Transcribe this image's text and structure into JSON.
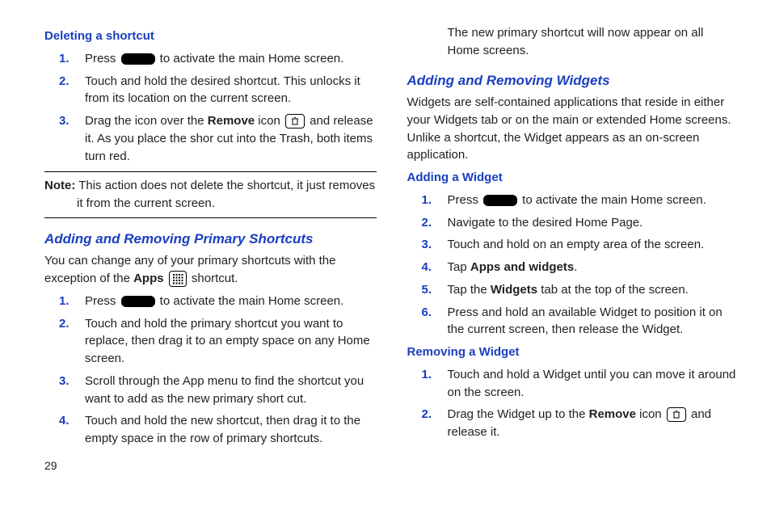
{
  "left": {
    "h_delete": "Deleting a shortcut",
    "del_steps": [
      {
        "n": "1.",
        "pre": "Press ",
        "post": " to activate the main Home screen.",
        "icon": "pill"
      },
      {
        "n": "2.",
        "text": "Touch and hold the desired shortcut. This unlocks it from its location on the current screen."
      },
      {
        "n": "3.",
        "pre": "Drag the icon over the ",
        "bold1": "Remove",
        "mid1": " icon ",
        "icon": "trash",
        "post": " and release it. As you place the shor cut into the Trash, both items turn red."
      }
    ],
    "note_label": "Note:",
    "note_text": " This action does not delete the shortcut, it just removes it from the current screen.",
    "h_primary": "Adding and Removing Primary Shortcuts",
    "primary_intro_pre": "You can change any of your primary shortcuts with the exception of the ",
    "primary_intro_bold": "Apps",
    "primary_intro_mid": " ",
    "primary_intro_post": " shortcut.",
    "primary_steps": [
      {
        "n": "1.",
        "pre": "Press ",
        "post": " to activate the main Home screen.",
        "icon": "pill"
      },
      {
        "n": "2.",
        "text": "Touch and hold the primary shortcut you want to replace, then drag it to an empty space on any Home screen."
      },
      {
        "n": "3.",
        "text": "Scroll through the App menu to find the shortcut you want to add as the new primary short cut."
      },
      {
        "n": "4.",
        "text": "Touch and hold the new shortcut, then drag it to the empty space in the row of primary shortcuts."
      }
    ],
    "page_number": "29"
  },
  "right": {
    "primary_tail": "The new primary shortcut will now appear on all Home screens.",
    "h_widgets": "Adding and Removing Widgets",
    "widgets_intro": "Widgets are self-contained applications that reside in either your Widgets tab or on the main or extended Home screens. Unlike a shortcut, the Widget appears as an on-screen application.",
    "h_add_widget": "Adding a Widget",
    "add_steps": [
      {
        "n": "1.",
        "pre": "Press ",
        "post": " to activate the main Home screen.",
        "icon": "pill"
      },
      {
        "n": "2.",
        "text": "Navigate to the desired Home Page."
      },
      {
        "n": "3.",
        "text": "Touch and hold on an empty area of the screen."
      },
      {
        "n": "4.",
        "pre": "Tap ",
        "bold1": "Apps and widgets",
        "post": "."
      },
      {
        "n": "5.",
        "pre": "Tap the ",
        "bold1": "Widgets",
        "post": " tab at the top of the screen."
      },
      {
        "n": "6.",
        "text": "Press and hold an available Widget to position it on the current screen, then release the Widget."
      }
    ],
    "h_rem_widget": "Removing a Widget",
    "rem_steps": [
      {
        "n": "1.",
        "text": "Touch and hold a Widget until you can move it around on the screen."
      },
      {
        "n": "2.",
        "pre": "Drag the Widget up to the ",
        "bold1": "Remove",
        "mid1": " icon ",
        "icon": "trash",
        "post": " and release it."
      }
    ]
  }
}
